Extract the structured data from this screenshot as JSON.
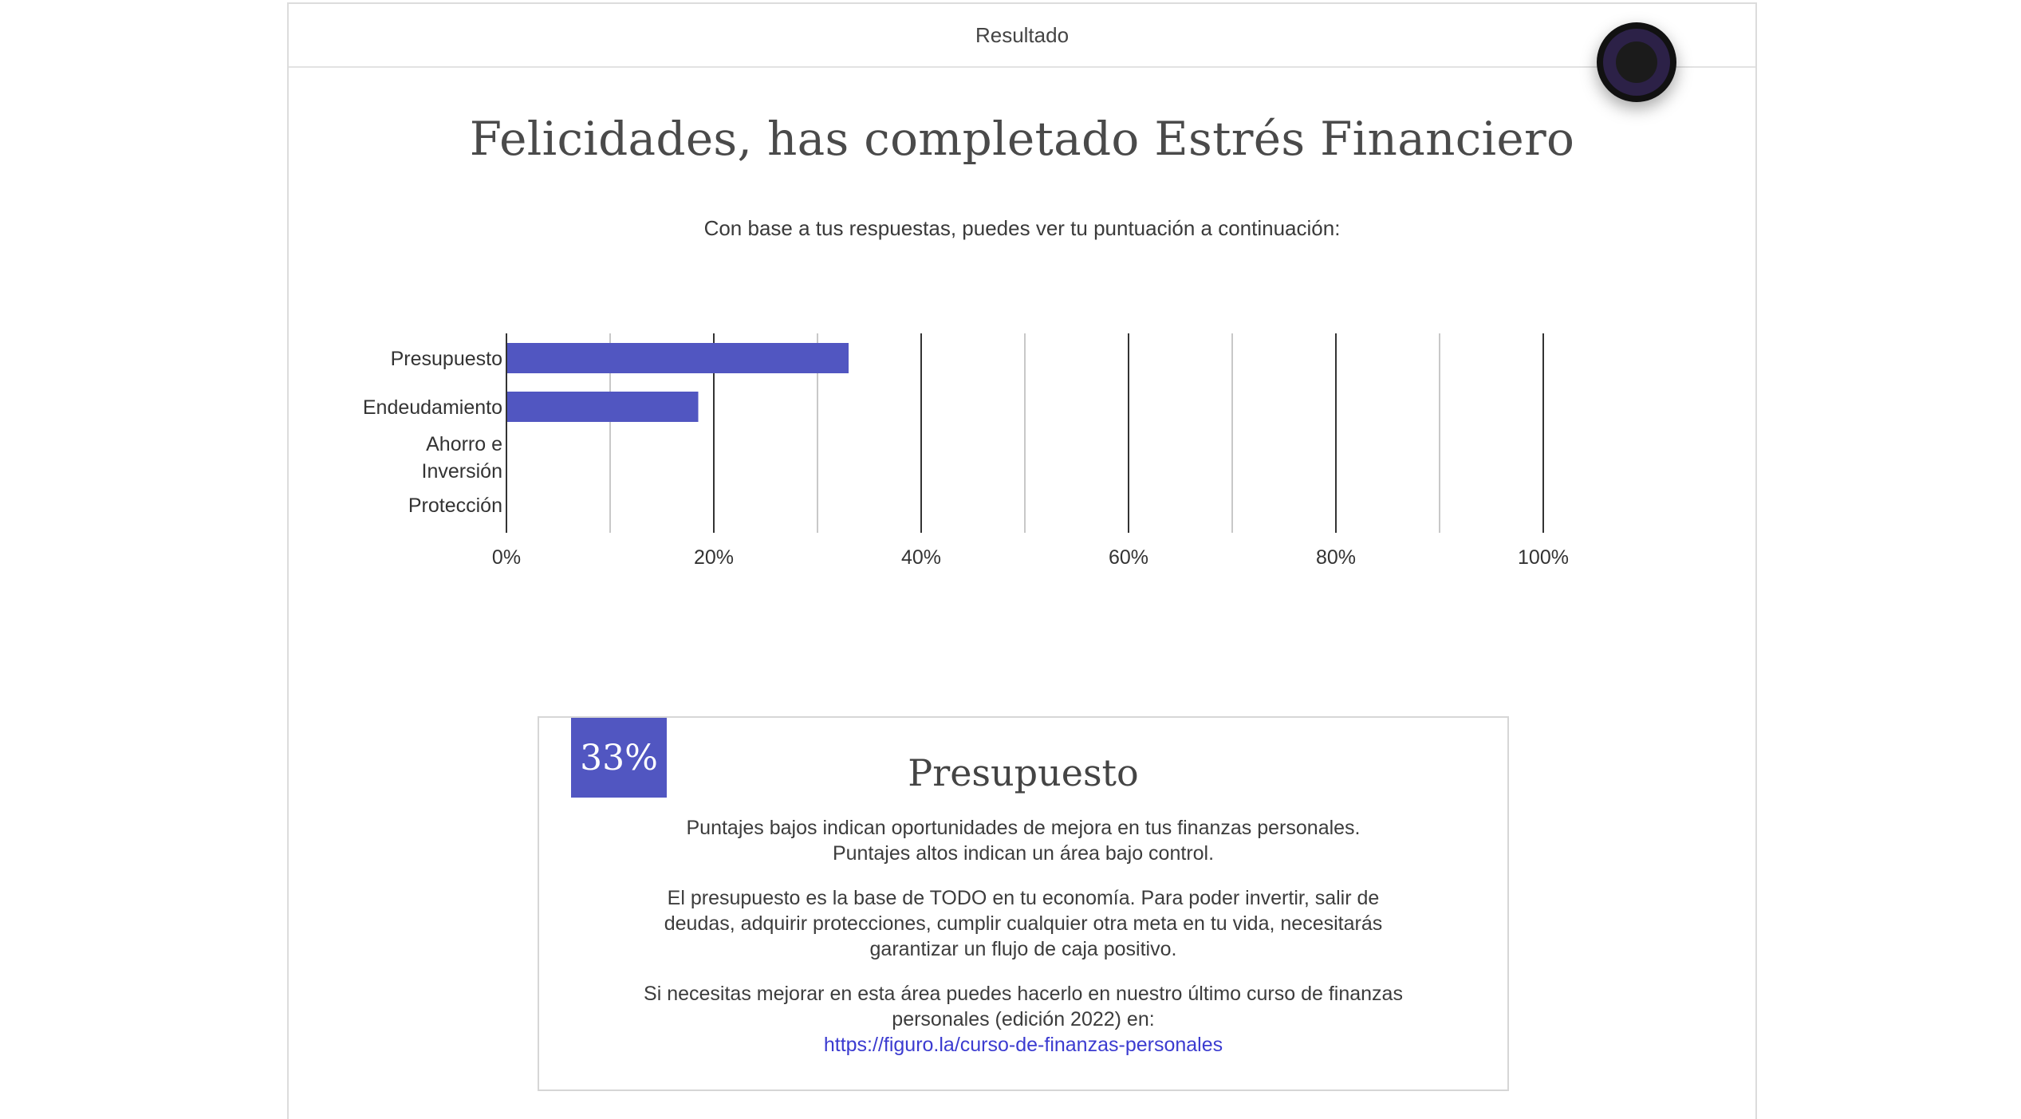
{
  "header": {
    "title": "Resultado"
  },
  "page": {
    "title": "Felicidades, has completado Estrés Financiero",
    "subtitle": "Con base a tus respuestas, puedes ver tu puntuación a continuación:"
  },
  "colors": {
    "accent": "#5156c1",
    "link": "#3b3bd0"
  },
  "chart_data": {
    "type": "bar",
    "orientation": "horizontal",
    "categories": [
      "Presupuesto",
      "Endeudamiento",
      "Ahorro e Inversión",
      "Protección"
    ],
    "category_lines": [
      [
        "Presupuesto"
      ],
      [
        "Endeudamiento"
      ],
      [
        "Ahorro e",
        "Inversión"
      ],
      [
        "Protección"
      ]
    ],
    "values": [
      33,
      18.5,
      0,
      0
    ],
    "xlim": [
      0,
      100
    ],
    "xticks": [
      "0%",
      "20%",
      "40%",
      "60%",
      "80%",
      "100%"
    ],
    "grid": true,
    "bar_color": "#5156c1"
  },
  "score_card": {
    "badge": "33%",
    "title": "Presupuesto",
    "paragraph1_line1": "Puntajes bajos indican oportunidades de mejora en tus finanzas personales.",
    "paragraph1_line2": "Puntajes altos indican un área bajo control.",
    "paragraph2": "El presupuesto es la base de TODO en tu economía. Para poder invertir, salir de deudas, adquirir protecciones, cumplir cualquier otra meta en tu vida, necesitarás garantizar un flujo de caja positivo.",
    "paragraph3": "Si necesitas mejorar en esta área puedes hacerlo en nuestro último curso de finanzas personales (edición 2022) en:",
    "link": "https://figuro.la/curso-de-finanzas-personales"
  }
}
